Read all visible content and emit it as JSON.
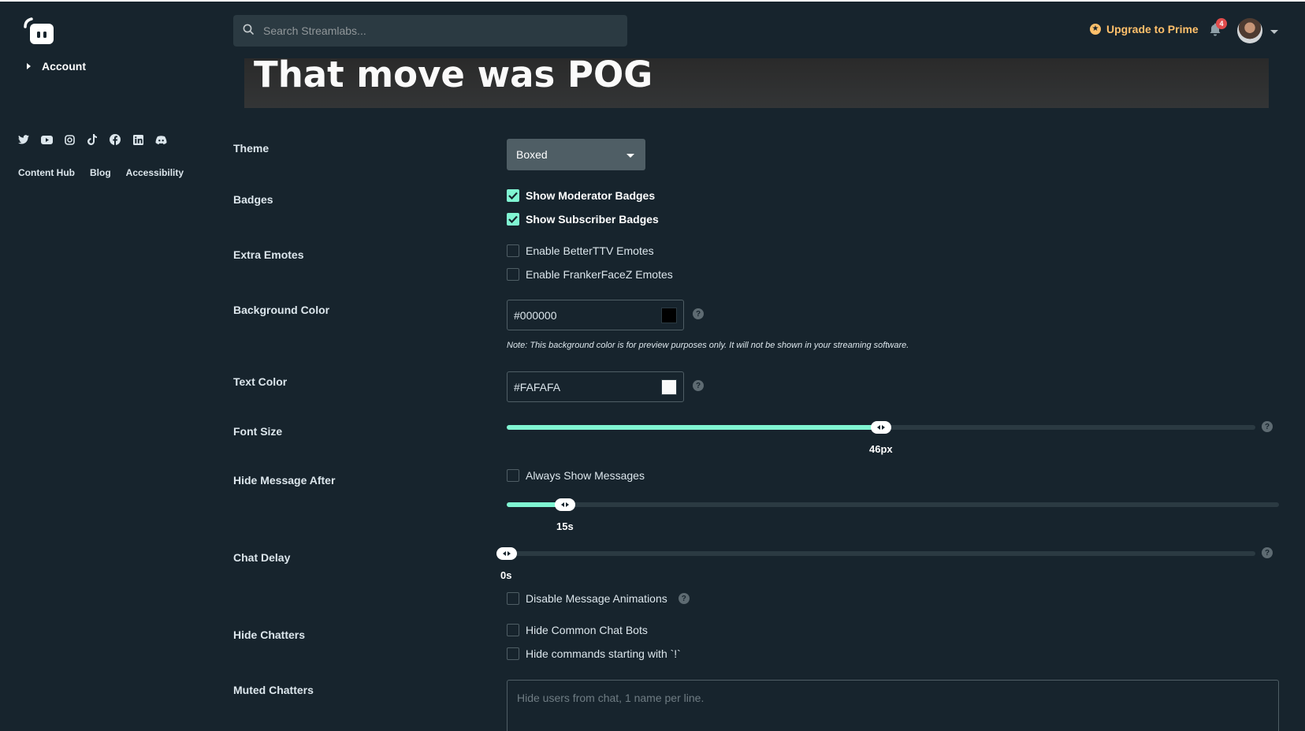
{
  "sidebar": {
    "account_label": "Account",
    "socials": [
      "twitter-icon",
      "youtube-icon",
      "instagram-icon",
      "tiktok-icon",
      "facebook-icon",
      "linkedin-icon",
      "discord-icon"
    ],
    "links": [
      "Content Hub",
      "Blog",
      "Accessibility"
    ]
  },
  "header": {
    "search_placeholder": "Search Streamlabs...",
    "prime_label": "Upgrade to Prime",
    "notification_count": "4"
  },
  "preview": {
    "message": "That move was POG"
  },
  "form": {
    "theme": {
      "label": "Theme",
      "value": "Boxed"
    },
    "badges": {
      "label": "Badges",
      "moderator": "Show Moderator Badges",
      "subscriber": "Show Subscriber Badges",
      "moderator_checked": true,
      "subscriber_checked": true
    },
    "extra_emotes": {
      "label": "Extra Emotes",
      "bttv": "Enable BetterTTV Emotes",
      "ffz": "Enable FrankerFaceZ Emotes"
    },
    "background_color": {
      "label": "Background Color",
      "value": "#000000",
      "note": "Note: This background color is for preview purposes only. It will not be shown in your streaming software."
    },
    "text_color": {
      "label": "Text Color",
      "value": "#FAFAFA"
    },
    "font_size": {
      "label": "Font Size",
      "value_label": "46px",
      "fraction": 0.5
    },
    "hide_message": {
      "label": "Hide Message After",
      "always_show": "Always Show Messages",
      "value_label": "15s",
      "fraction": 0.075
    },
    "chat_delay": {
      "label": "Chat Delay",
      "value_label": "0s",
      "fraction": 0
    },
    "disable_animations": "Disable Message Animations",
    "hide_chatters": {
      "label": "Hide Chatters",
      "bots": "Hide Common Chat Bots",
      "commands": "Hide commands starting with `!`"
    },
    "muted_chatters": {
      "label": "Muted Chatters",
      "placeholder": "Hide users from chat, 1 name per line."
    }
  },
  "colors": {
    "accent": "#80f5d2",
    "background": "#17242d",
    "prime": "#ffc06b"
  }
}
